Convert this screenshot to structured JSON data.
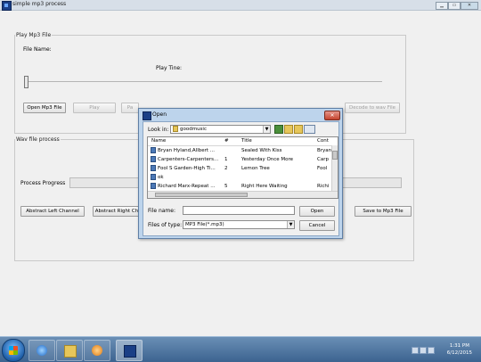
{
  "window": {
    "title": "simple mp3 process"
  },
  "play_group": {
    "legend": "Play Mp3 File",
    "file_name_label": "File Name:",
    "play_time_label": "Play Tine:",
    "seek_level": 0,
    "buttons": [
      "Open Mp3 File",
      "Play",
      "Pa",
      "Decode to wav File"
    ]
  },
  "wav_group": {
    "legend": "Wav file process",
    "progress_label": "Process Progress",
    "progress_value": 0,
    "buttons": [
      "Abstract Left Channel",
      "Abstract Right Ch",
      "Save to Mp3 File"
    ]
  },
  "dialog": {
    "title": "Open",
    "close_glyph": "✕",
    "look_in_label": "Look in:",
    "look_in_value": "goodmusic",
    "columns": [
      "Name",
      "#",
      "Title",
      "Cont"
    ],
    "rows": [
      {
        "name": "Bryan Hyland,Allbert ...",
        "num": "",
        "title": "Sealed With Kiss",
        "cont": "Bryan"
      },
      {
        "name": "Carpenters-Carpenters...",
        "num": "1",
        "title": "Yesterday Once More",
        "cont": "Carp"
      },
      {
        "name": "Fool S Garden-High Ti...",
        "num": "2",
        "title": "Lemon Tree",
        "cont": "Fool"
      },
      {
        "name": "ok",
        "num": "",
        "title": "",
        "cont": ""
      },
      {
        "name": "Richard Marx-Repeat ...",
        "num": "5",
        "title": "Right Here Waiting",
        "cont": "Richi"
      }
    ],
    "file_name_label": "File name:",
    "file_name_value": "",
    "files_of_type_label": "Files of type:",
    "files_of_type_value": "MP3 File(*.mp3)",
    "open_button": "Open",
    "cancel_button": "Cancel"
  },
  "taskbar": {
    "time": "1:31 PM",
    "date": "6/12/2015"
  }
}
